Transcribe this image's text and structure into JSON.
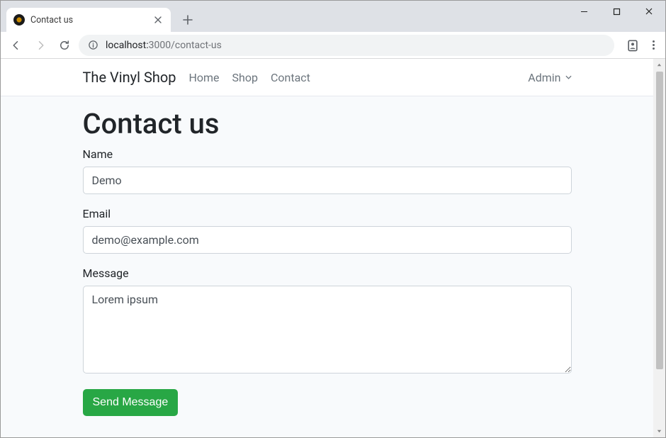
{
  "browser": {
    "tab_title": "Contact us",
    "url_host": "localhost:",
    "url_port": "3000",
    "url_path": "/contact-us"
  },
  "navbar": {
    "brand": "The Vinyl Shop",
    "links": [
      "Home",
      "Shop",
      "Contact"
    ],
    "admin_label": "Admin"
  },
  "page": {
    "heading": "Contact us"
  },
  "form": {
    "name_label": "Name",
    "name_value": "Demo",
    "email_label": "Email",
    "email_value": "demo@example.com",
    "message_label": "Message",
    "message_value": "Lorem ipsum",
    "submit_label": "Send Message"
  }
}
